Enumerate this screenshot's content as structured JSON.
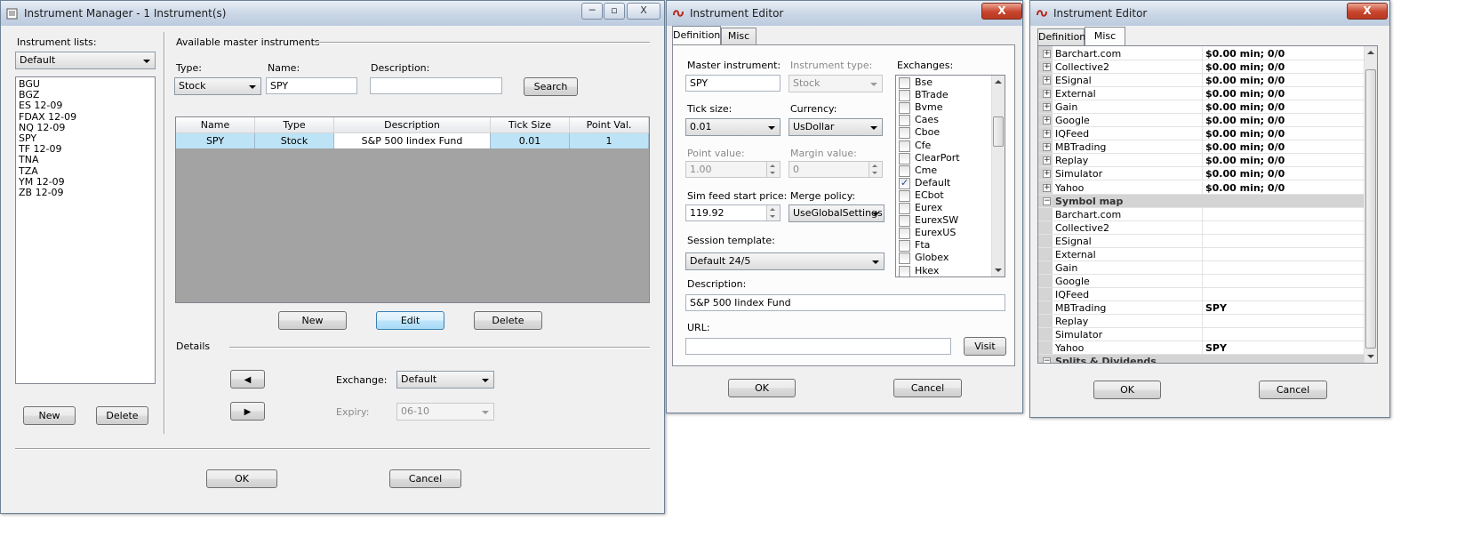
{
  "colors": {
    "selection": "#bde3f6",
    "grid_background": "#a3a3a3",
    "title_gradient": "#c9d6e6",
    "close_red": "#c7442d"
  },
  "win1": {
    "title": "Instrument Manager - 1 Instrument(s)",
    "controls": {
      "minimize": "─",
      "maximize": "▫",
      "close": "X"
    },
    "instrument_lists_label": "Instrument lists:",
    "list_select": "Default",
    "instruments": [
      "BGU",
      "BGZ",
      "ES 12-09",
      "FDAX 12-09",
      "NQ 12-09",
      "SPY",
      "TF 12-09",
      "TNA",
      "TZA",
      "YM 12-09",
      "ZB 12-09"
    ],
    "left_new": "New",
    "left_delete": "Delete",
    "available_label": "Available master instruments",
    "type_label": "Type:",
    "type_value": "Stock",
    "name_label": "Name:",
    "name_value": "SPY",
    "description_label": "Description:",
    "description_value": "",
    "search_button": "Search",
    "grid": {
      "headers": [
        "Name",
        "Type",
        "Description",
        "Tick Size",
        "Point Val."
      ],
      "row": [
        "SPY",
        "Stock",
        "S&P 500 Iindex Fund",
        "0.01",
        "1"
      ]
    },
    "new_button": "New",
    "edit_button": "Edit",
    "delete_button": "Delete",
    "details_label": "Details",
    "exchange_label": "Exchange:",
    "exchange_value": "Default",
    "expiry_label": "Expiry:",
    "expiry_value": "06-10",
    "ok_button": "OK",
    "cancel_button": "Cancel",
    "prev_arrow": "◀",
    "next_arrow": "▶"
  },
  "win2": {
    "title": "Instrument Editor",
    "close": "X",
    "tabs": [
      "Definition",
      "Misc"
    ],
    "master_label": "Master instrument:",
    "master_value": "SPY",
    "inst_type_label": "Instrument type:",
    "inst_type_value": "Stock",
    "exchanges_label": "Exchanges:",
    "exchanges": [
      {
        "name": "Bse",
        "checked": false
      },
      {
        "name": "BTrade",
        "checked": false
      },
      {
        "name": "Bvme",
        "checked": false
      },
      {
        "name": "Caes",
        "checked": false
      },
      {
        "name": "Cboe",
        "checked": false
      },
      {
        "name": "Cfe",
        "checked": false
      },
      {
        "name": "ClearPort",
        "checked": false
      },
      {
        "name": "Cme",
        "checked": false
      },
      {
        "name": "Default",
        "checked": true
      },
      {
        "name": "ECbot",
        "checked": false
      },
      {
        "name": "Eurex",
        "checked": false
      },
      {
        "name": "EurexSW",
        "checked": false
      },
      {
        "name": "EurexUS",
        "checked": false
      },
      {
        "name": "Fta",
        "checked": false
      },
      {
        "name": "Globex",
        "checked": false
      },
      {
        "name": "Hkex",
        "checked": false
      }
    ],
    "checkmark": "✓",
    "tick_label": "Tick size:",
    "tick_value": "0.01",
    "currency_label": "Currency:",
    "currency_value": "UsDollar",
    "point_label": "Point value:",
    "point_value": "1.00",
    "margin_label": "Margin value:",
    "margin_value": "0",
    "sim_label": "Sim feed start price:",
    "sim_value": "119.92",
    "merge_label": "Merge policy:",
    "merge_value": "UseGlobalSettings",
    "session_label": "Session template:",
    "session_value": "Default 24/5",
    "desc_label": "Description:",
    "desc_value": "S&P 500 Iindex Fund",
    "url_label": "URL:",
    "url_value": "",
    "visit_button": "Visit",
    "ok_button": "OK",
    "cancel_button": "Cancel"
  },
  "win3": {
    "title": "Instrument Editor",
    "close": "X",
    "tabs": [
      "Definition",
      "Misc"
    ],
    "expand_glyph": "+",
    "collapse_glyph": "−",
    "rows": [
      {
        "name": "Barchart.com",
        "value": "$0.00 min;  0/0",
        "kind": "item",
        "exp": "+"
      },
      {
        "name": "Collective2",
        "value": "$0.00 min;  0/0",
        "kind": "item",
        "exp": "+"
      },
      {
        "name": "ESignal",
        "value": "$0.00 min;  0/0",
        "kind": "item",
        "exp": "+"
      },
      {
        "name": "External",
        "value": "$0.00 min;  0/0",
        "kind": "item",
        "exp": "+"
      },
      {
        "name": "Gain",
        "value": "$0.00 min;  0/0",
        "kind": "item",
        "exp": "+"
      },
      {
        "name": "Google",
        "value": "$0.00 min;  0/0",
        "kind": "item",
        "exp": "+"
      },
      {
        "name": "IQFeed",
        "value": "$0.00 min;  0/0",
        "kind": "item",
        "exp": "+"
      },
      {
        "name": "MBTrading",
        "value": "$0.00 min;  0/0",
        "kind": "item",
        "exp": "+"
      },
      {
        "name": "Replay",
        "value": "$0.00 min;  0/0",
        "kind": "item",
        "exp": "+"
      },
      {
        "name": "Simulator",
        "value": "$0.00 min;  0/0",
        "kind": "item",
        "exp": "+"
      },
      {
        "name": "Yahoo",
        "value": "$0.00 min;  0/0",
        "kind": "item",
        "exp": "+"
      },
      {
        "name": "Symbol map",
        "value": "",
        "kind": "category",
        "exp": "−"
      },
      {
        "name": "Barchart.com",
        "value": "",
        "kind": "child",
        "exp": ""
      },
      {
        "name": "Collective2",
        "value": "",
        "kind": "child",
        "exp": ""
      },
      {
        "name": "ESignal",
        "value": "",
        "kind": "child",
        "exp": ""
      },
      {
        "name": "External",
        "value": "",
        "kind": "child",
        "exp": ""
      },
      {
        "name": "Gain",
        "value": "",
        "kind": "child",
        "exp": ""
      },
      {
        "name": "Google",
        "value": "",
        "kind": "child",
        "exp": ""
      },
      {
        "name": "IQFeed",
        "value": "",
        "kind": "child",
        "exp": ""
      },
      {
        "name": "MBTrading",
        "value": "SPY",
        "kind": "child",
        "exp": ""
      },
      {
        "name": "Replay",
        "value": "",
        "kind": "child",
        "exp": ""
      },
      {
        "name": "Simulator",
        "value": "",
        "kind": "child",
        "exp": ""
      },
      {
        "name": "Yahoo",
        "value": "SPY",
        "kind": "child",
        "exp": ""
      },
      {
        "name": "Splits & Dividends",
        "value": "",
        "kind": "category",
        "exp": "−"
      }
    ],
    "ok_button": "OK",
    "cancel_button": "Cancel"
  }
}
